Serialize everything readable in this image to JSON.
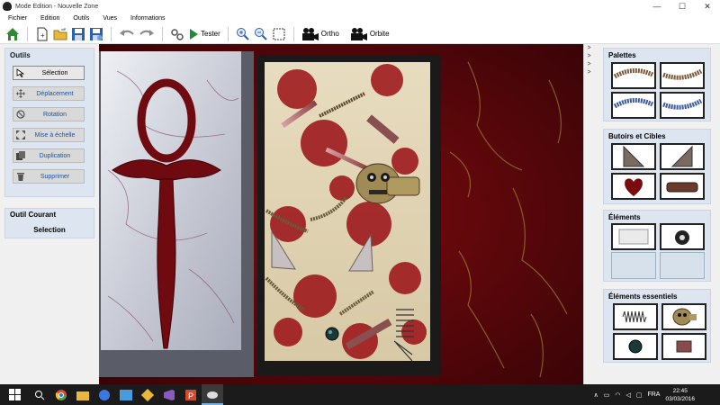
{
  "window": {
    "title": "Mode Edition - Nouvelle Zone"
  },
  "menu": [
    "Fichier",
    "Edition",
    "Outils",
    "Vues",
    "Informations"
  ],
  "toolbar": {
    "test_label": "Tester",
    "ortho_label": "Ortho",
    "orbit_label": "Orbite"
  },
  "tools": {
    "title": "Outils",
    "items": [
      {
        "label": "Sélection",
        "icon": "cursor-icon",
        "active": true
      },
      {
        "label": "Déplacement",
        "icon": "move-icon",
        "active": false
      },
      {
        "label": "Rotation",
        "icon": "rotation-icon",
        "active": false
      },
      {
        "label": "Mise à échelle",
        "icon": "scale-icon",
        "active": false
      },
      {
        "label": "Duplication",
        "icon": "duplicate-icon",
        "active": false
      },
      {
        "label": "Supprimer",
        "icon": "trash-icon",
        "active": false
      }
    ]
  },
  "current_tool": {
    "title": "Outil Courant",
    "value": "Selection"
  },
  "right": {
    "palettes": {
      "title": "Palettes"
    },
    "bumpers": {
      "title": "Butoirs et Cibles"
    },
    "elements": {
      "title": "Éléments"
    },
    "essentials": {
      "title": "Éléments essentiels"
    }
  },
  "strip_arrows": [
    ">",
    ">",
    ">",
    ">"
  ],
  "window_controls": [
    "—",
    "☐",
    "✕"
  ],
  "taskbar": {
    "time": "22:45",
    "date": "03/03/2016",
    "lang": "FRA"
  },
  "colors": {
    "panel_group": "#dde6f0",
    "accent_blue": "#1a55a0",
    "blood": "#7a0a0e",
    "taskbar": "#1b1b1b"
  }
}
